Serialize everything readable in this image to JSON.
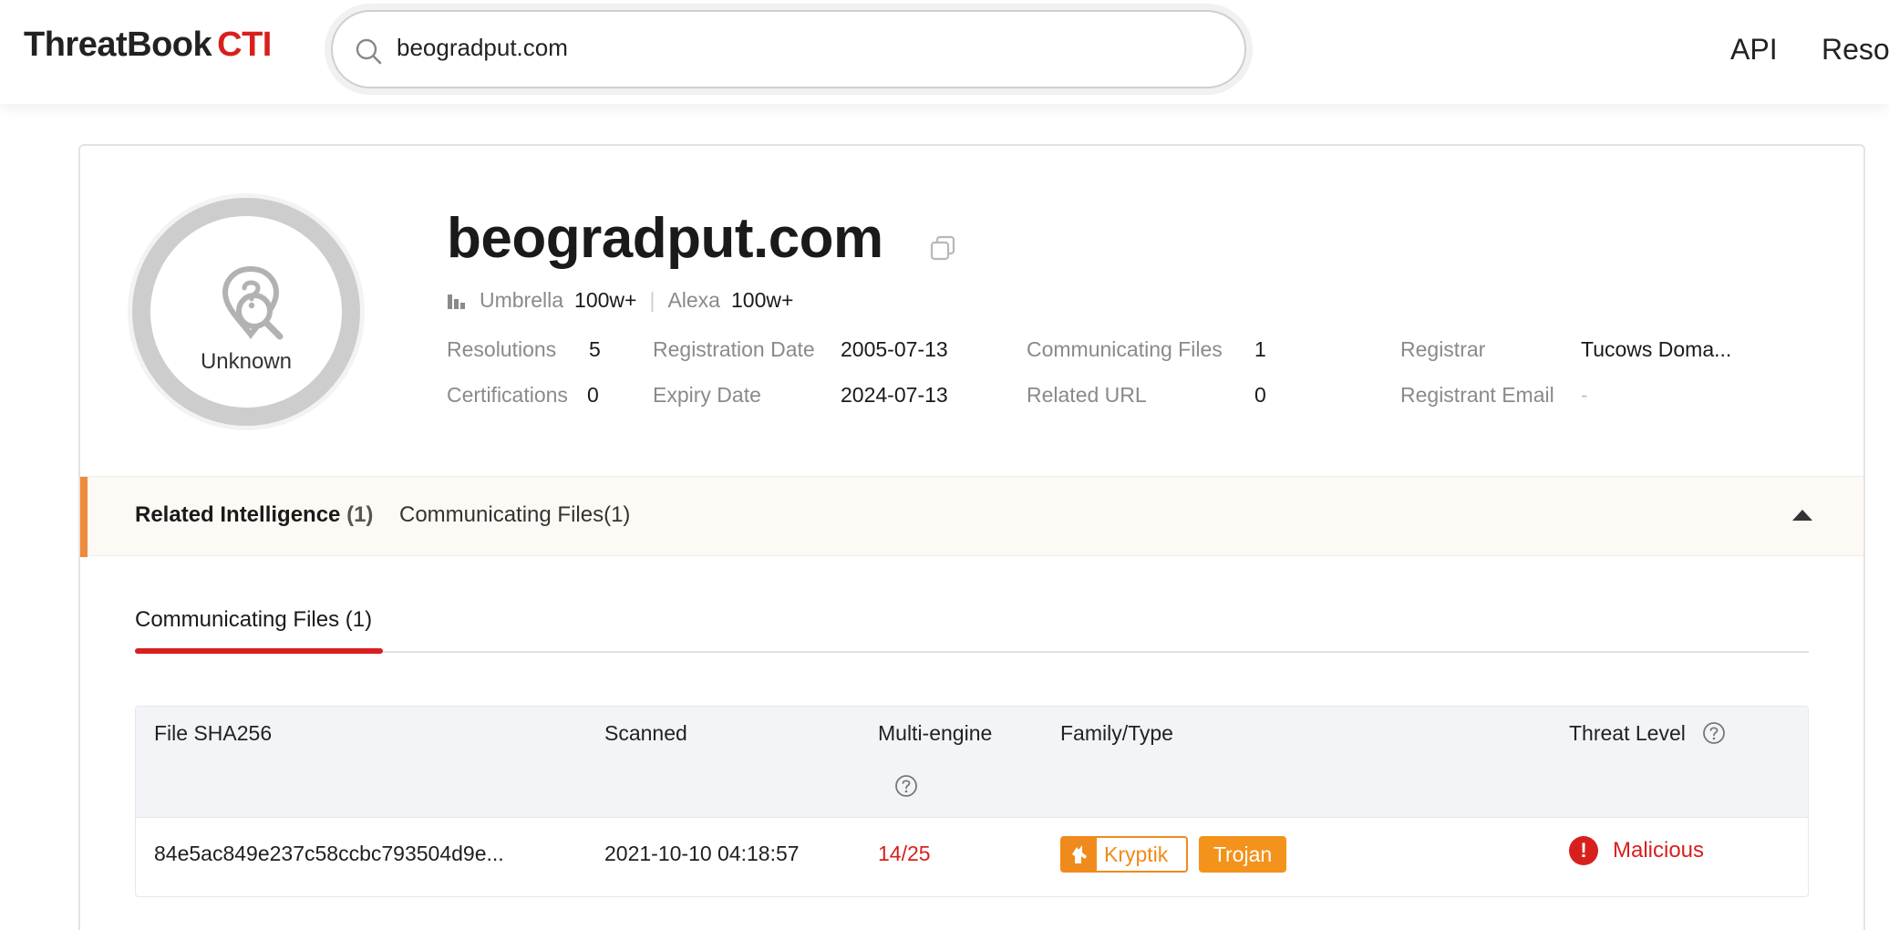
{
  "header": {
    "logo_main": "ThreatBook",
    "logo_suffix": "CTI",
    "search_value": "beogradput.com",
    "nav": [
      "API",
      "Reso"
    ]
  },
  "overview": {
    "verdict": "Unknown",
    "domain": "beogradput.com",
    "ranks": {
      "umbrella_label": "Umbrella",
      "umbrella_value": "100w+",
      "alexa_label": "Alexa",
      "alexa_value": "100w+"
    },
    "fields": {
      "resolutions_label": "Resolutions",
      "resolutions_value": "5",
      "certifications_label": "Certifications",
      "certifications_value": "0",
      "registration_date_label": "Registration Date",
      "registration_date_value": "2005-07-13",
      "expiry_date_label": "Expiry Date",
      "expiry_date_value": "2024-07-13",
      "communicating_files_label": "Communicating Files",
      "communicating_files_value": "1",
      "related_url_label": "Related URL",
      "related_url_value": "0",
      "registrar_label": "Registrar",
      "registrar_value": "Tucows Doma...",
      "registrant_email_label": "Registrant Email",
      "registrant_email_value": "-"
    }
  },
  "related": {
    "title": "Related Intelligence",
    "count": "(1)",
    "tab": "Communicating Files(1)"
  },
  "subtab": {
    "label": "Communicating Files (1)"
  },
  "table": {
    "columns": {
      "sha256": "File SHA256",
      "scanned": "Scanned",
      "multi_engine": "Multi-engine",
      "family": "Family/Type",
      "threat_level": "Threat Level"
    },
    "rows": [
      {
        "sha256": "84e5ac849e237c58ccbc793504d9e...",
        "scanned": "2021-10-10 04:18:57",
        "engine": "14/25",
        "family": "Kryptik",
        "type": "Trojan",
        "threat": "Malicious"
      }
    ]
  },
  "colors": {
    "brand_red": "#d7201d",
    "accent_orange": "#f08a3c",
    "tag_orange": "#f3931c"
  }
}
